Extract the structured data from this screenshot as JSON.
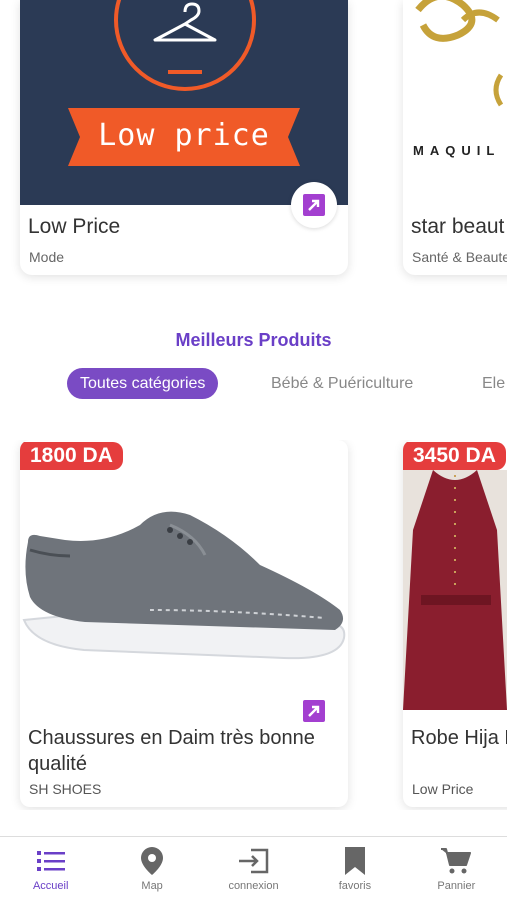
{
  "colors": {
    "accent": "#6a3fc7",
    "pill": "#7a4bc4",
    "price": "#e53d3d",
    "navy": "#2b3a55",
    "orange": "#f05a28"
  },
  "shops": [
    {
      "name": "Low Price",
      "category": "Mode",
      "banner_text": "Low price",
      "icon": "hanger-icon"
    },
    {
      "name": "star beaut",
      "category": "Santé & Beaute",
      "banner_text": "MAQUIL"
    }
  ],
  "section": {
    "title": "Meilleurs Produits",
    "categories": [
      "Toutes catégories",
      "Bébé & Puériculture",
      "Ele"
    ]
  },
  "products": [
    {
      "price": "1800 DA",
      "name": "Chaussures en Daim très bonne qualité",
      "shop": "SH SHOES"
    },
    {
      "price": "3450 DA",
      "name": "Robe Hija Femme",
      "shop": "Low Price"
    }
  ],
  "nav": [
    {
      "label": "Accueil",
      "icon": "list-icon",
      "active": true
    },
    {
      "label": "Map",
      "icon": "map-pin-icon"
    },
    {
      "label": "connexion",
      "icon": "login-icon"
    },
    {
      "label": "favoris",
      "icon": "bookmark-icon"
    },
    {
      "label": "Pannier",
      "icon": "cart-icon"
    }
  ]
}
